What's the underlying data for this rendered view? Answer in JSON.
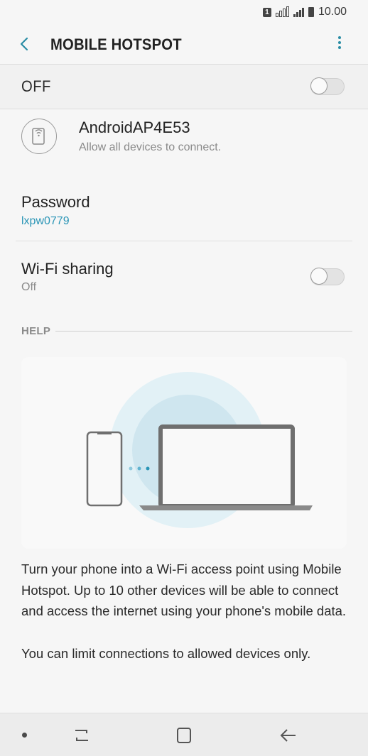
{
  "status": {
    "sim": "1",
    "time": "10.00"
  },
  "appbar": {
    "title": "MOBILE HOTSPOT"
  },
  "master": {
    "label": "OFF",
    "enabled": false
  },
  "network": {
    "name": "AndroidAP4E53",
    "subtitle": "Allow all devices to connect."
  },
  "password": {
    "label": "Password",
    "value": "lxpw0779"
  },
  "wifi_sharing": {
    "label": "Wi-Fi sharing",
    "status": "Off",
    "enabled": false
  },
  "help": {
    "header": "HELP",
    "paragraphs": [
      "Turn your phone into a Wi-Fi access point using Mobile Hotspot. Up to 10 other devices will be able to connect and access the internet using your phone's mobile data.",
      "You can limit connections to allowed devices only."
    ]
  },
  "colors": {
    "accent": "#2a95b6",
    "background": "#f6f6f6",
    "illustration_circle": "#d3e9f1"
  },
  "icons": {
    "back": "back-arrow-icon",
    "more": "more-options-icon",
    "network": "hotspot-phone-icon",
    "nav_recents": "recents-icon",
    "nav_home": "home-icon",
    "nav_back": "nav-back-icon"
  }
}
